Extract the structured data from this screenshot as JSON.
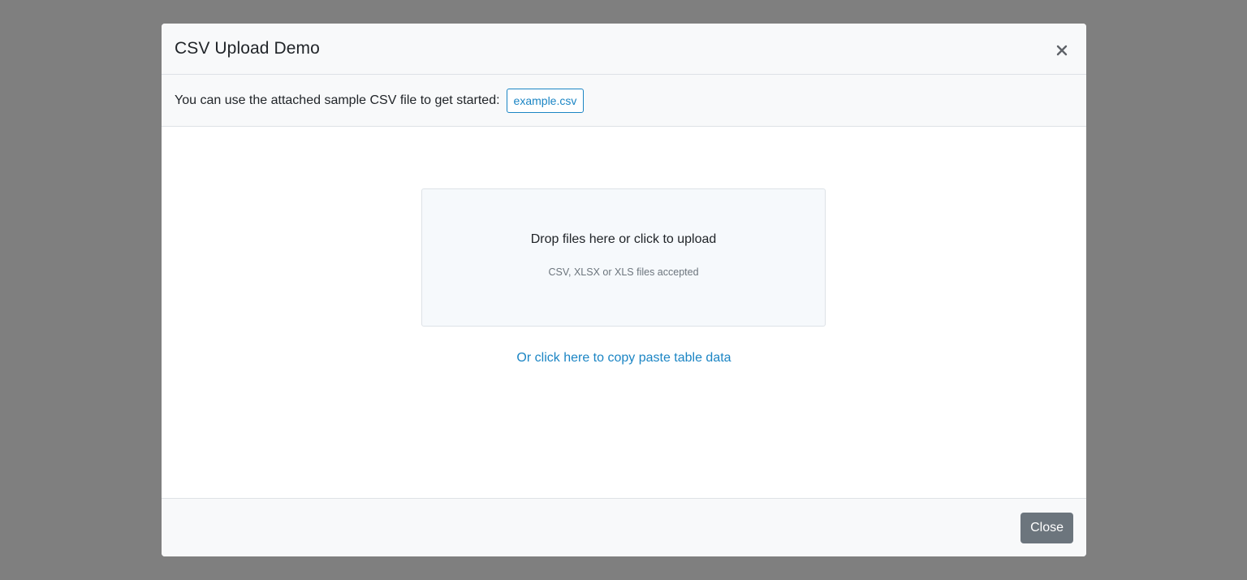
{
  "modal": {
    "title": "CSV Upload Demo",
    "close_icon": "close-icon"
  },
  "sample": {
    "text": "You can use the attached sample CSV file to get started:",
    "file_label": "example.csv"
  },
  "dropzone": {
    "title": "Drop files here or click to upload",
    "subtitle": "CSV, XLSX or XLS files accepted"
  },
  "paste_link": "Or click here to copy paste table data",
  "footer": {
    "close_label": "Close"
  },
  "colors": {
    "backdrop": "#7f7f7f",
    "link": "#1b85c4",
    "secondary_button": "#6c757d",
    "header_bg": "#f8f9fa",
    "dropzone_bg": "#f6f9fc"
  }
}
